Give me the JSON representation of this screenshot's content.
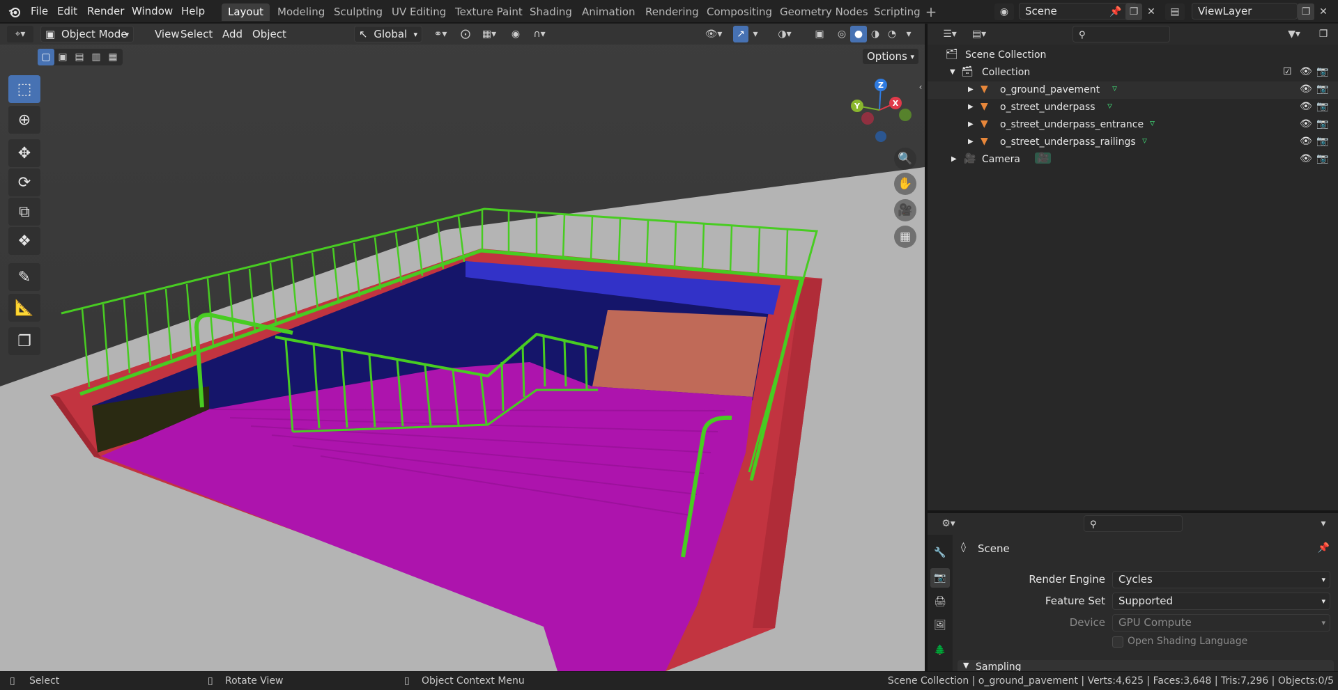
{
  "app": {
    "name": "Blender"
  },
  "menu": [
    "File",
    "Edit",
    "Render",
    "Window",
    "Help"
  ],
  "workspaces": [
    "Layout",
    "Modeling",
    "Sculpting",
    "UV Editing",
    "Texture Paint",
    "Shading",
    "Animation",
    "Rendering",
    "Compositing",
    "Geometry Nodes",
    "Scripting"
  ],
  "active_workspace": "Layout",
  "scene": {
    "name": "Scene"
  },
  "view_layer": {
    "name": "ViewLayer"
  },
  "viewport": {
    "mode": "Object Mode",
    "menus": [
      "View",
      "Select",
      "Add",
      "Object"
    ],
    "orientation": "Global",
    "options_label": "Options",
    "gizmo_axes": {
      "x": "X",
      "y": "Y",
      "z": "Z"
    }
  },
  "tools": [
    "select-box",
    "cursor",
    "move",
    "rotate",
    "scale",
    "transform",
    "annotate",
    "measure",
    "add-cube"
  ],
  "outliner": {
    "root": "Scene Collection",
    "collection": "Collection",
    "objects": [
      "o_ground_pavement",
      "o_street_underpass",
      "o_street_underpass_entrance",
      "o_street_underpass_railings"
    ],
    "camera": "Camera"
  },
  "properties": {
    "context": "Scene",
    "render_engine_label": "Render Engine",
    "render_engine": "Cycles",
    "feature_set_label": "Feature Set",
    "feature_set": "Supported",
    "device_label": "Device",
    "device": "GPU Compute",
    "osl_label": "Open Shading Language",
    "sampling_label": "Sampling"
  },
  "status": {
    "select": "Select",
    "rotate": "Rotate View",
    "context_menu": "Object Context Menu",
    "stats": "Scene Collection | o_ground_pavement | Verts:4,625 | Faces:3,648 | Tris:7,296 | Objects:0/5"
  },
  "colors": {
    "accent": "#4772b3",
    "railing": "#44cc22",
    "wall": "#c8323c",
    "floor": "#b21ab2",
    "inner_wall": "#1a1a6e"
  }
}
